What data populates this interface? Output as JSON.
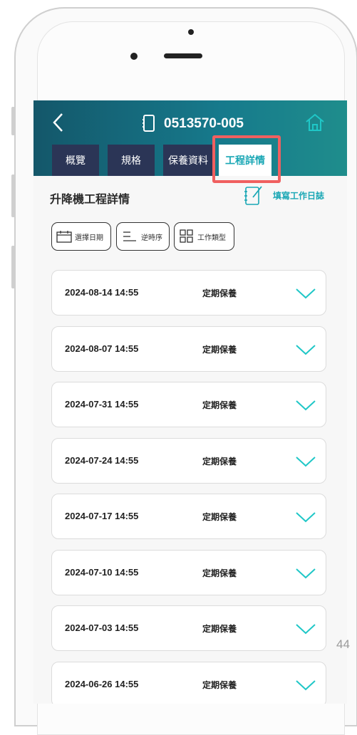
{
  "header": {
    "device_id": "0513570-005"
  },
  "tabs": [
    {
      "label": "概覽",
      "active": false
    },
    {
      "label": "規格",
      "active": false
    },
    {
      "label": "保養資料",
      "active": false
    },
    {
      "label": "工程詳情",
      "active": true
    }
  ],
  "section": {
    "title": "升降機工程詳情",
    "write_log_label": "填寫工作日誌"
  },
  "filters": {
    "date_label": "選擇日期",
    "order_label": "逆時序",
    "type_label": "工作類型"
  },
  "records": [
    {
      "date": "2024-08-14 14:55",
      "type": "定期保養"
    },
    {
      "date": "2024-08-07 14:55",
      "type": "定期保養"
    },
    {
      "date": "2024-07-31 14:55",
      "type": "定期保養"
    },
    {
      "date": "2024-07-24 14:55",
      "type": "定期保養"
    },
    {
      "date": "2024-07-17 14:55",
      "type": "定期保養"
    },
    {
      "date": "2024-07-10 14:55",
      "type": "定期保養"
    },
    {
      "date": "2024-07-03 14:55",
      "type": "定期保養"
    },
    {
      "date": "2024-06-26 14:55",
      "type": "定期保養"
    }
  ],
  "page_number": "44",
  "colors": {
    "accent": "#1aa7b5",
    "header": "#167a8c",
    "tab_bg": "#2b3556",
    "highlight": "#f06060"
  },
  "icons": [
    "back-arrow-icon",
    "device-icon",
    "home-icon",
    "edit-note-icon",
    "calendar-icon",
    "sort-lines-icon",
    "grid-icon",
    "chevron-down-icon"
  ]
}
